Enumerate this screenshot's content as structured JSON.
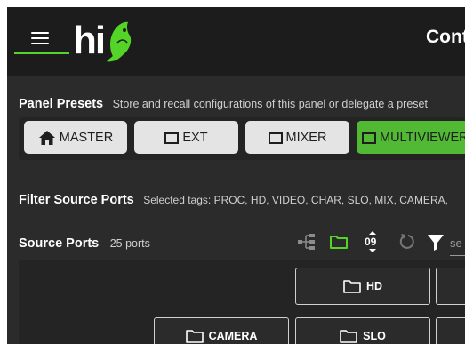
{
  "header": {
    "logo_text": "hi",
    "title": "Cont",
    "accent_color": "#54d427"
  },
  "presets": {
    "title": "Panel Presets",
    "description": "Store and recall configurations of this panel or delegate a preset",
    "buttons": [
      {
        "label": "MASTER",
        "icon": "home-icon",
        "active": false
      },
      {
        "label": "EXT",
        "icon": "window-icon",
        "active": false
      },
      {
        "label": "MIXER",
        "icon": "window-icon",
        "active": false
      },
      {
        "label": "MULTIVIEWER",
        "icon": "window-icon",
        "active": true
      }
    ]
  },
  "filter": {
    "title": "Filter Source Ports",
    "selected_tags": "Selected tags: PROC, HD, VIDEO, CHAR, SLO, MIX, CAMERA,"
  },
  "source_ports": {
    "title": "Source Ports",
    "count": "25 ports",
    "sort_label": "09",
    "search_placeholder": "se",
    "tags_row1": [
      "HD"
    ],
    "tags_row2": [
      "CAMERA",
      "SLO"
    ]
  }
}
